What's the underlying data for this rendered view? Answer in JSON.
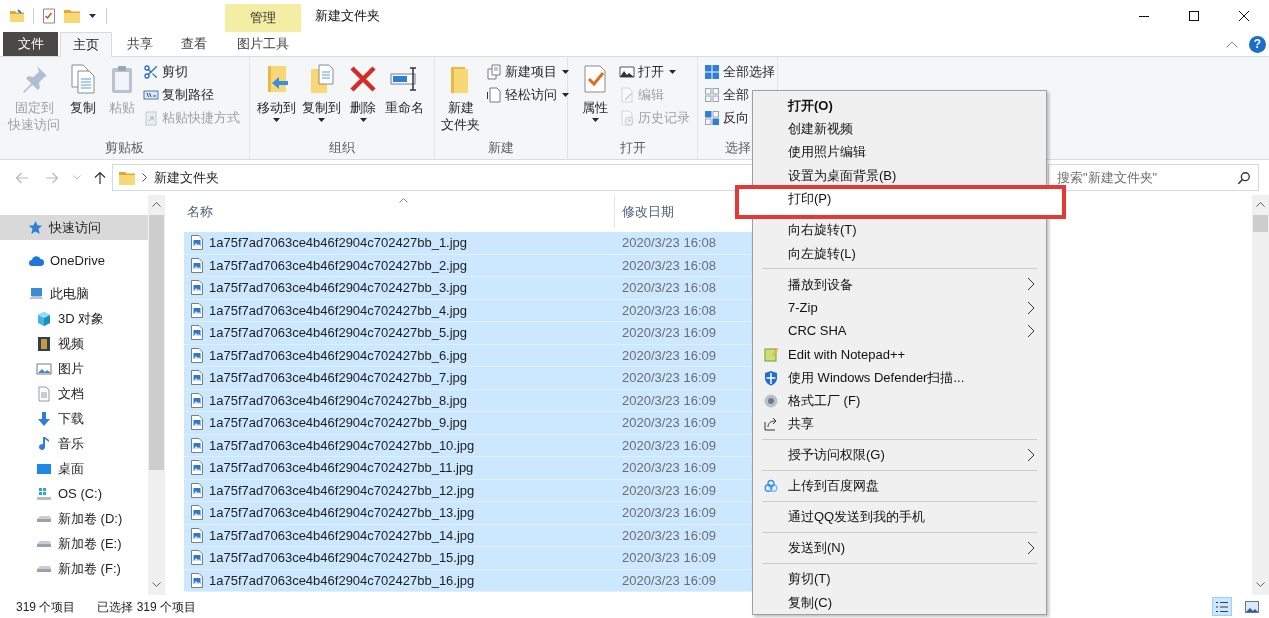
{
  "title_bar": {
    "contextual_header": "管理",
    "title": "新建文件夹"
  },
  "tabs": [
    {
      "label": "文件",
      "kind": "file",
      "selected": false
    },
    {
      "label": "主页",
      "kind": "tab",
      "selected": true
    },
    {
      "label": "共享",
      "kind": "tab",
      "selected": false
    },
    {
      "label": "查看",
      "kind": "tab",
      "selected": false
    },
    {
      "label": "图片工具",
      "kind": "contextual",
      "selected": false
    }
  ],
  "help": "?",
  "ribbon": {
    "groups": [
      {
        "label": "剪贴板",
        "large": [
          {
            "lines": [
              "固定到",
              "快速访问"
            ],
            "disabled": true,
            "dropdown": false
          },
          {
            "lines": [
              "复制"
            ],
            "disabled": false,
            "dropdown": false
          },
          {
            "lines": [
              "粘贴"
            ],
            "disabled": true,
            "dropdown": false
          }
        ],
        "small": [
          {
            "label": "剪切",
            "disabled": false,
            "dropdown": false
          },
          {
            "label": "复制路径",
            "disabled": false,
            "dropdown": false
          },
          {
            "label": "粘贴快捷方式",
            "disabled": true,
            "dropdown": false
          }
        ]
      },
      {
        "label": "组织",
        "large": [
          {
            "lines": [
              "移动到"
            ],
            "disabled": false,
            "dropdown": true
          },
          {
            "lines": [
              "复制到"
            ],
            "disabled": false,
            "dropdown": true
          },
          {
            "lines": [
              "删除"
            ],
            "disabled": false,
            "dropdown": true
          },
          {
            "lines": [
              "重命名"
            ],
            "disabled": false,
            "dropdown": false
          }
        ]
      },
      {
        "label": "新建",
        "large": [
          {
            "lines": [
              "新建",
              "文件夹"
            ],
            "disabled": false,
            "dropdown": false
          }
        ],
        "small": [
          {
            "label": "新建项目",
            "disabled": false,
            "dropdown": true
          },
          {
            "label": "轻松访问",
            "disabled": false,
            "dropdown": true
          }
        ]
      },
      {
        "label": "打开",
        "large": [
          {
            "lines": [
              "属性"
            ],
            "disabled": false,
            "dropdown": true
          }
        ],
        "small": [
          {
            "label": "打开",
            "disabled": false,
            "dropdown": true
          },
          {
            "label": "编辑",
            "disabled": true,
            "dropdown": false
          },
          {
            "label": "历史记录",
            "disabled": true,
            "dropdown": false
          }
        ]
      },
      {
        "label": "选择",
        "small": [
          {
            "label": "全部选择",
            "disabled": false,
            "dropdown": false
          },
          {
            "label": "全部",
            "disabled": false,
            "dropdown": false
          },
          {
            "label": "反向",
            "disabled": false,
            "dropdown": false
          }
        ]
      }
    ]
  },
  "address_bar": {
    "nav_buttons": [
      {
        "disabled": true
      },
      {
        "disabled": true
      },
      {
        "disabled": true
      },
      {
        "disabled": false
      }
    ],
    "path": [
      "新建文件夹"
    ],
    "search_placeholder": "搜索\"新建文件夹\""
  },
  "navigation_pane": {
    "items": [
      {
        "label": "快速访问",
        "selected": true
      },
      {
        "label": "OneDrive",
        "selected": false
      },
      {
        "label": "此电脑",
        "selected": false,
        "children": [
          {
            "label": "3D 对象",
            "selected": false
          },
          {
            "label": "视频",
            "selected": false
          },
          {
            "label": "图片",
            "selected": false
          },
          {
            "label": "文档",
            "selected": false
          },
          {
            "label": "下载",
            "selected": false
          },
          {
            "label": "音乐",
            "selected": false
          },
          {
            "label": "桌面",
            "selected": false
          },
          {
            "label": "OS (C:)",
            "selected": false
          },
          {
            "label": "新加卷 (D:)",
            "selected": false
          },
          {
            "label": "新加卷 (E:)",
            "selected": false
          },
          {
            "label": "新加卷 (F:)",
            "selected": false
          }
        ]
      }
    ]
  },
  "file_list": {
    "columns": [
      {
        "label": "名称",
        "sorted": true
      },
      {
        "label": "修改日期",
        "sorted": false
      }
    ],
    "rows": [
      {
        "name": "1a75f7ad7063ce4b46f2904c702427bb_1.jpg",
        "modified": "2020/3/23 16:08",
        "selected": true
      },
      {
        "name": "1a75f7ad7063ce4b46f2904c702427bb_2.jpg",
        "modified": "2020/3/23 16:08",
        "selected": true
      },
      {
        "name": "1a75f7ad7063ce4b46f2904c702427bb_3.jpg",
        "modified": "2020/3/23 16:08",
        "selected": true
      },
      {
        "name": "1a75f7ad7063ce4b46f2904c702427bb_4.jpg",
        "modified": "2020/3/23 16:08",
        "selected": true
      },
      {
        "name": "1a75f7ad7063ce4b46f2904c702427bb_5.jpg",
        "modified": "2020/3/23 16:09",
        "selected": true
      },
      {
        "name": "1a75f7ad7063ce4b46f2904c702427bb_6.jpg",
        "modified": "2020/3/23 16:09",
        "selected": true
      },
      {
        "name": "1a75f7ad7063ce4b46f2904c702427bb_7.jpg",
        "modified": "2020/3/23 16:09",
        "selected": true
      },
      {
        "name": "1a75f7ad7063ce4b46f2904c702427bb_8.jpg",
        "modified": "2020/3/23 16:09",
        "selected": true
      },
      {
        "name": "1a75f7ad7063ce4b46f2904c702427bb_9.jpg",
        "modified": "2020/3/23 16:09",
        "selected": true
      },
      {
        "name": "1a75f7ad7063ce4b46f2904c702427bb_10.jpg",
        "modified": "2020/3/23 16:09",
        "selected": true
      },
      {
        "name": "1a75f7ad7063ce4b46f2904c702427bb_11.jpg",
        "modified": "2020/3/23 16:09",
        "selected": true
      },
      {
        "name": "1a75f7ad7063ce4b46f2904c702427bb_12.jpg",
        "modified": "2020/3/23 16:09",
        "selected": true
      },
      {
        "name": "1a75f7ad7063ce4b46f2904c702427bb_13.jpg",
        "modified": "2020/3/23 16:09",
        "selected": true
      },
      {
        "name": "1a75f7ad7063ce4b46f2904c702427bb_14.jpg",
        "modified": "2020/3/23 16:09",
        "selected": true
      },
      {
        "name": "1a75f7ad7063ce4b46f2904c702427bb_15.jpg",
        "modified": "2020/3/23 16:09",
        "selected": true
      },
      {
        "name": "1a75f7ad7063ce4b46f2904c702427bb_16.jpg",
        "modified": "2020/3/23 16:09",
        "selected": true
      }
    ]
  },
  "context_menu": {
    "items": [
      {
        "kind": "item",
        "label": "打开(O)",
        "default": true,
        "submenu": false,
        "framed": false
      },
      {
        "kind": "item",
        "label": "创建新视频",
        "default": false,
        "submenu": false,
        "framed": false
      },
      {
        "kind": "item",
        "label": "使用照片编辑",
        "default": false,
        "submenu": false,
        "framed": false
      },
      {
        "kind": "item",
        "label": "设置为桌面背景(B)",
        "default": false,
        "submenu": false,
        "framed": false
      },
      {
        "kind": "item",
        "label": "打印(P)",
        "default": false,
        "submenu": false,
        "framed": true
      },
      {
        "kind": "item",
        "label": "向右旋转(T)",
        "default": false,
        "submenu": false,
        "framed": false
      },
      {
        "kind": "item",
        "label": "向左旋转(L)",
        "default": false,
        "submenu": false,
        "framed": false
      },
      {
        "kind": "separator"
      },
      {
        "kind": "item",
        "label": "播放到设备",
        "default": false,
        "submenu": true,
        "framed": false
      },
      {
        "kind": "item",
        "label": "7-Zip",
        "default": false,
        "submenu": true,
        "framed": false
      },
      {
        "kind": "item",
        "label": "CRC SHA",
        "default": false,
        "submenu": true,
        "framed": false
      },
      {
        "kind": "item",
        "label": "Edit with Notepad++",
        "default": false,
        "submenu": false,
        "framed": false
      },
      {
        "kind": "item",
        "label": "使用 Windows Defender扫描...",
        "default": false,
        "submenu": false,
        "framed": false
      },
      {
        "kind": "item",
        "label": "格式工厂 (F)",
        "default": false,
        "submenu": false,
        "framed": false
      },
      {
        "kind": "item",
        "label": "共享",
        "default": false,
        "submenu": false,
        "framed": false
      },
      {
        "kind": "separator"
      },
      {
        "kind": "item",
        "label": "授予访问权限(G)",
        "default": false,
        "submenu": true,
        "framed": false
      },
      {
        "kind": "separator"
      },
      {
        "kind": "item",
        "label": "上传到百度网盘",
        "default": false,
        "submenu": false,
        "framed": false
      },
      {
        "kind": "separator"
      },
      {
        "kind": "item",
        "label": "通过QQ发送到我的手机",
        "default": false,
        "submenu": false,
        "framed": false
      },
      {
        "kind": "separator"
      },
      {
        "kind": "item",
        "label": "发送到(N)",
        "default": false,
        "submenu": true,
        "framed": false
      },
      {
        "kind": "separator"
      },
      {
        "kind": "item",
        "label": "剪切(T)",
        "default": false,
        "submenu": false,
        "framed": false
      },
      {
        "kind": "item",
        "label": "复制(C)",
        "default": false,
        "submenu": false,
        "framed": false
      }
    ]
  },
  "status_bar": {
    "item_count": "319 个项目",
    "selection": "已选择 319 个项目",
    "view_buttons": [
      {
        "selected": true
      },
      {
        "selected": false
      }
    ]
  }
}
